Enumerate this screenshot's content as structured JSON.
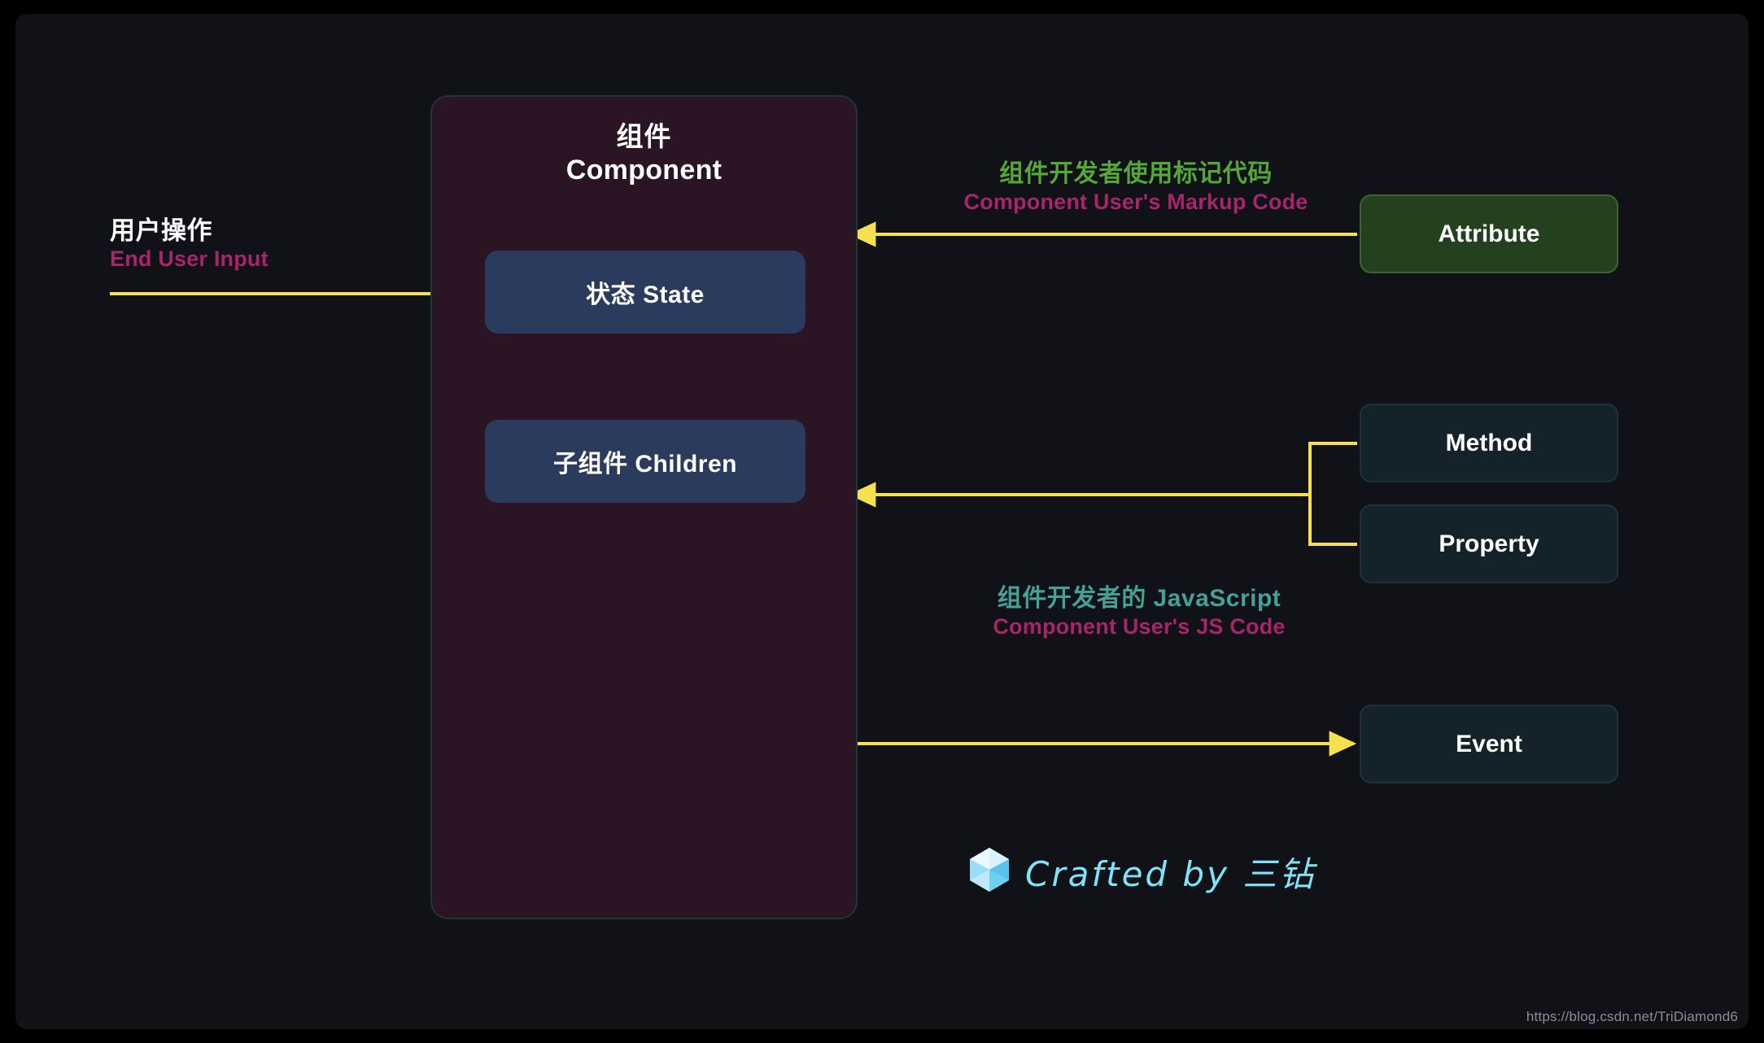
{
  "canvas": {
    "background": "#111118",
    "outer_background": "#000000"
  },
  "component": {
    "title_cn": "组件",
    "title_en": "Component",
    "fill": "#2b1424",
    "border": "#1d3733",
    "children": [
      {
        "name": "state",
        "label": "状态 State",
        "fill": "#2b3b5e"
      },
      {
        "name": "children",
        "label": "子组件 Children",
        "fill": "#2b3b5e"
      }
    ]
  },
  "labels": {
    "end_user": {
      "cn": "用户操作",
      "en": "End User Input",
      "cn_color": "#ffffff",
      "en_color": "#a6256b"
    },
    "markup": {
      "cn": "组件开发者使用标记代码",
      "en": "Component User's Markup Code",
      "cn_color": "#54a838",
      "en_color": "#a6256b"
    },
    "js": {
      "cn": "组件开发者的 JavaScript",
      "en": "Component User's JS Code",
      "cn_color": "#45a096",
      "en_color": "#a6256b"
    }
  },
  "nodes": {
    "attribute": {
      "label": "Attribute",
      "fill": "#24401f",
      "border": "#3c6331"
    },
    "method": {
      "label": "Method",
      "fill": "#14222a",
      "border": "#1e323a"
    },
    "property": {
      "label": "Property",
      "fill": "#14222a",
      "border": "#1e323a"
    },
    "event": {
      "label": "Event",
      "fill": "#14222a",
      "border": "#1e323a"
    }
  },
  "connectors": {
    "color": "#f5e04f",
    "items": [
      {
        "name": "end-user-to-state",
        "from": "End User Input",
        "to": "状态 State",
        "direction": "right"
      },
      {
        "name": "state-to-children",
        "from": "状态 State",
        "to": "子组件 Children",
        "direction": "down"
      },
      {
        "name": "attribute-to-component",
        "from": "Attribute",
        "to": "组件 Component",
        "direction": "left"
      },
      {
        "name": "methodproperty-to-component",
        "from": "Method / Property",
        "to": "子组件 Children",
        "direction": "left"
      },
      {
        "name": "component-to-event",
        "from": "组件 Component",
        "to": "Event",
        "direction": "right"
      }
    ]
  },
  "signature": {
    "text": "Crafted by 三钻",
    "icon": "diamond-cube-icon",
    "color": "#7fe3f5"
  },
  "watermark": {
    "url": "https://blog.csdn.net/TriDiamond6"
  }
}
